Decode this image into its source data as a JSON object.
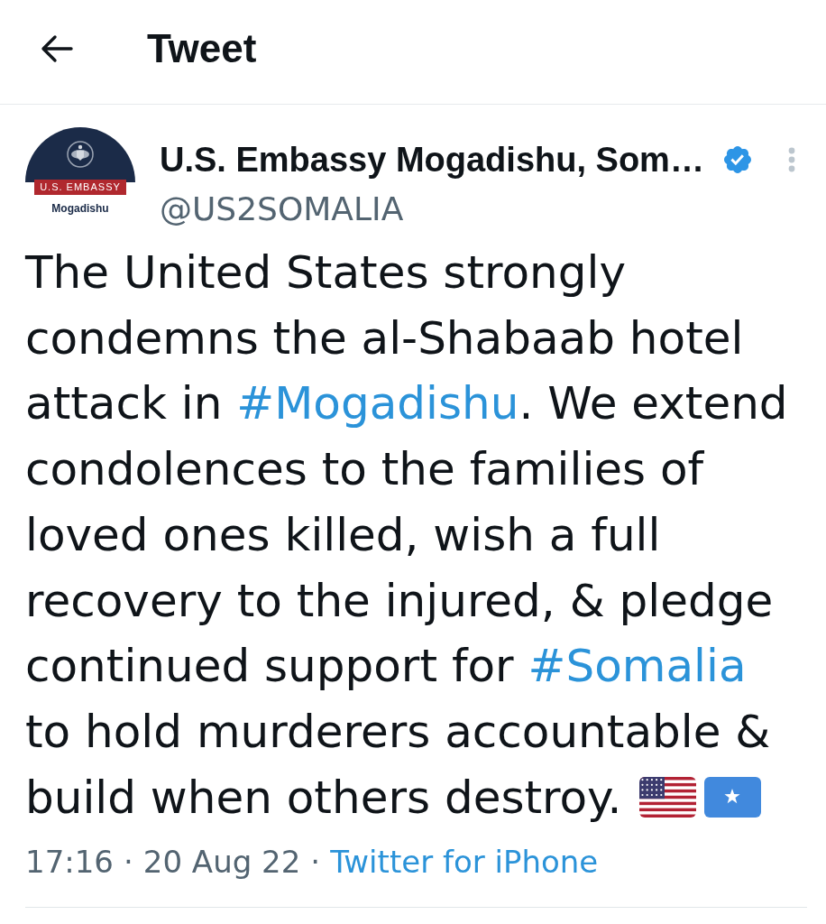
{
  "header": {
    "title": "Tweet"
  },
  "tweet": {
    "author": {
      "name": "U.S. Embassy Mogadishu, Som…",
      "handle": "@US2SOMALIA",
      "verified": true,
      "avatar": {
        "banner": "U.S. EMBASSY",
        "caption": "Mogadishu"
      }
    },
    "text": [
      {
        "kind": "text",
        "text": "The United States strongly condemns the al-Shabaab hotel attack in "
      },
      {
        "kind": "hashtag",
        "text": "#Mogadishu"
      },
      {
        "kind": "text",
        "text": ". We extend condolences to the families of loved ones killed, wish a full recovery to the injured, & pledge continued support for "
      },
      {
        "kind": "hashtag",
        "text": "#Somalia"
      },
      {
        "kind": "text",
        "text": " to hold murderers accountable & build when others destroy."
      }
    ],
    "meta": [
      {
        "kind": "time",
        "text": "17:16"
      },
      {
        "kind": "separator",
        "text": "·"
      },
      {
        "kind": "date",
        "text": "20 Aug 22"
      },
      {
        "kind": "separator",
        "text": "·"
      },
      {
        "kind": "link",
        "text": "Twitter for iPhone"
      }
    ]
  }
}
